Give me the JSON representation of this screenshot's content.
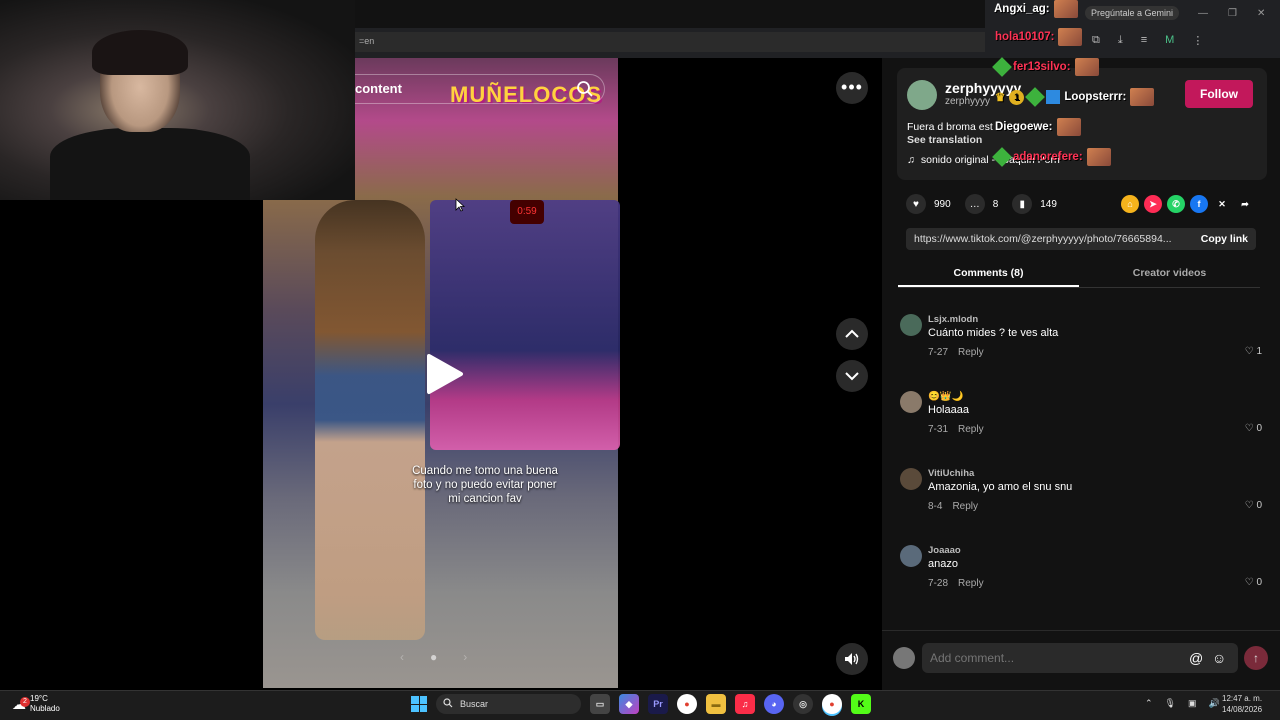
{
  "browser": {
    "address": "=en",
    "gemini_label": "Pregúntale a Gemini",
    "window_controls": [
      "—",
      "❐",
      "✕"
    ]
  },
  "feed": {
    "search_text": "content",
    "logo_text": "MUÑELOCOS",
    "arcade_display": "0:59",
    "caption": "Cuando me tomo una buena foto y no puedo evitar poner mi cancion fav",
    "more_label": "•••"
  },
  "post": {
    "username": "zerphyyyyy",
    "handle": "zerphyyyy",
    "follow_label": "Follow",
    "description": "Fuera d broma est",
    "see_translation": "See translation",
    "sound": "sonido original - Joaquin Porri",
    "likes": "990",
    "comments": "8",
    "saves": "149",
    "link": "https://www.tiktok.com/@zerphyyyyy/photo/76665894...",
    "copy_link": "Copy link"
  },
  "tabs": [
    {
      "label": "Comments (8)",
      "active": true
    },
    {
      "label": "Creator videos",
      "active": false
    }
  ],
  "comments": [
    {
      "user": "Lsjx.mlodn",
      "text": "Cuánto mides ? te ves alta",
      "date": "7-27",
      "reply": "Reply",
      "likes": "1"
    },
    {
      "user": "😊👑🌙",
      "text": "Holaaaa",
      "date": "7-31",
      "reply": "Reply",
      "likes": "0"
    },
    {
      "user": "VitiUchiha",
      "text": "Amazonia, yo amo el snu snu",
      "date": "8-4",
      "reply": "Reply",
      "likes": "0"
    },
    {
      "user": "Joaaao",
      "text": "anazo",
      "date": "7-28",
      "reply": "Reply",
      "likes": "0"
    }
  ],
  "comment_input": {
    "placeholder": "Add comment...",
    "at": "@",
    "emoji": "☺",
    "send": "↑"
  },
  "chat": [
    {
      "name": "Angxi_ag:",
      "color": "#ffffff"
    },
    {
      "name": "hola10107:",
      "color": "#ff3355"
    },
    {
      "name": "fer13silvo:",
      "color": "#ff3355"
    },
    {
      "name": "Loopsterrr:",
      "color": "#ffffff"
    },
    {
      "name": "Diegoewe:",
      "color": "#ffffff"
    },
    {
      "name": "adanorefere:",
      "color": "#ff3355"
    }
  ],
  "chat_badge_number": "1",
  "taskbar": {
    "temperature": "19°C",
    "weather": "Nublado",
    "weather_badge": "2",
    "search": "Buscar",
    "time": "12:47 a. m.",
    "date": "14/08/2026"
  }
}
